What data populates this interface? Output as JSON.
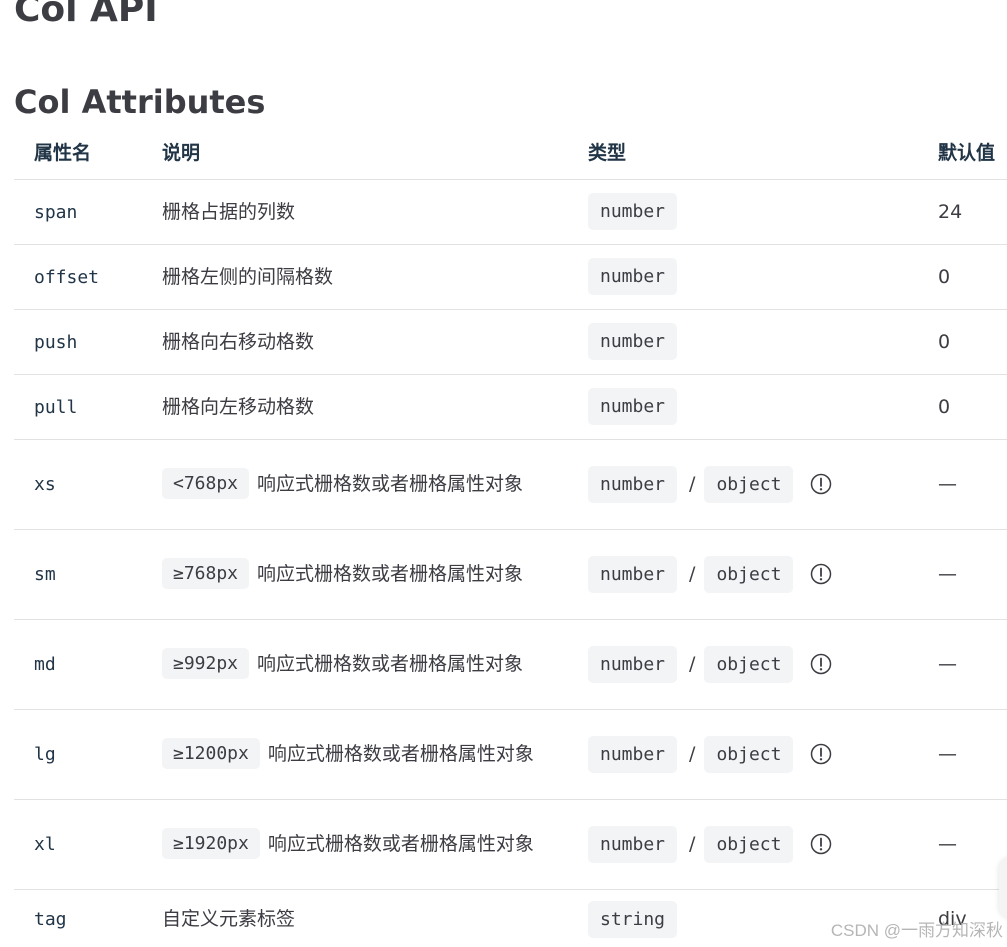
{
  "page_title": "Col API",
  "section_title": "Col Attributes",
  "table": {
    "headers": [
      "属性名",
      "说明",
      "类型",
      "默认值"
    ],
    "rows": [
      {
        "name": "span",
        "desc_chip": "",
        "desc": "栅格占据的列数",
        "types": [
          "number"
        ],
        "info": false,
        "default": "24"
      },
      {
        "name": "offset",
        "desc_chip": "",
        "desc": "栅格左侧的间隔格数",
        "types": [
          "number"
        ],
        "info": false,
        "default": "0"
      },
      {
        "name": "push",
        "desc_chip": "",
        "desc": "栅格向右移动格数",
        "types": [
          "number"
        ],
        "info": false,
        "default": "0"
      },
      {
        "name": "pull",
        "desc_chip": "",
        "desc": "栅格向左移动格数",
        "types": [
          "number"
        ],
        "info": false,
        "default": "0"
      },
      {
        "name": "xs",
        "desc_chip": "<768px",
        "desc": "响应式栅格数或者栅格属性对象",
        "types": [
          "number",
          "object"
        ],
        "info": true,
        "default": "—"
      },
      {
        "name": "sm",
        "desc_chip": "≥768px",
        "desc": "响应式栅格数或者栅格属性对象",
        "types": [
          "number",
          "object"
        ],
        "info": true,
        "default": "—"
      },
      {
        "name": "md",
        "desc_chip": "≥992px",
        "desc": "响应式栅格数或者栅格属性对象",
        "types": [
          "number",
          "object"
        ],
        "info": true,
        "default": "—"
      },
      {
        "name": "lg",
        "desc_chip": "≥1200px",
        "desc": "响应式栅格数或者栅格属性对象",
        "types": [
          "number",
          "object"
        ],
        "info": true,
        "default": "—"
      },
      {
        "name": "xl",
        "desc_chip": "≥1920px",
        "desc": "响应式栅格数或者栅格属性对象",
        "types": [
          "number",
          "object"
        ],
        "info": true,
        "default": "—"
      },
      {
        "name": "tag",
        "desc_chip": "",
        "desc": "自定义元素标签",
        "types": [
          "string"
        ],
        "info": false,
        "default": "div"
      }
    ],
    "type_separator": "/",
    "info_icon": "info-circle-icon"
  },
  "watermark": "CSDN @一雨方知深秋",
  "colors": {
    "heading": "#3c3c43",
    "text": "#213547",
    "chip_bg": "#f3f4f6",
    "border": "#e2e2e3"
  }
}
